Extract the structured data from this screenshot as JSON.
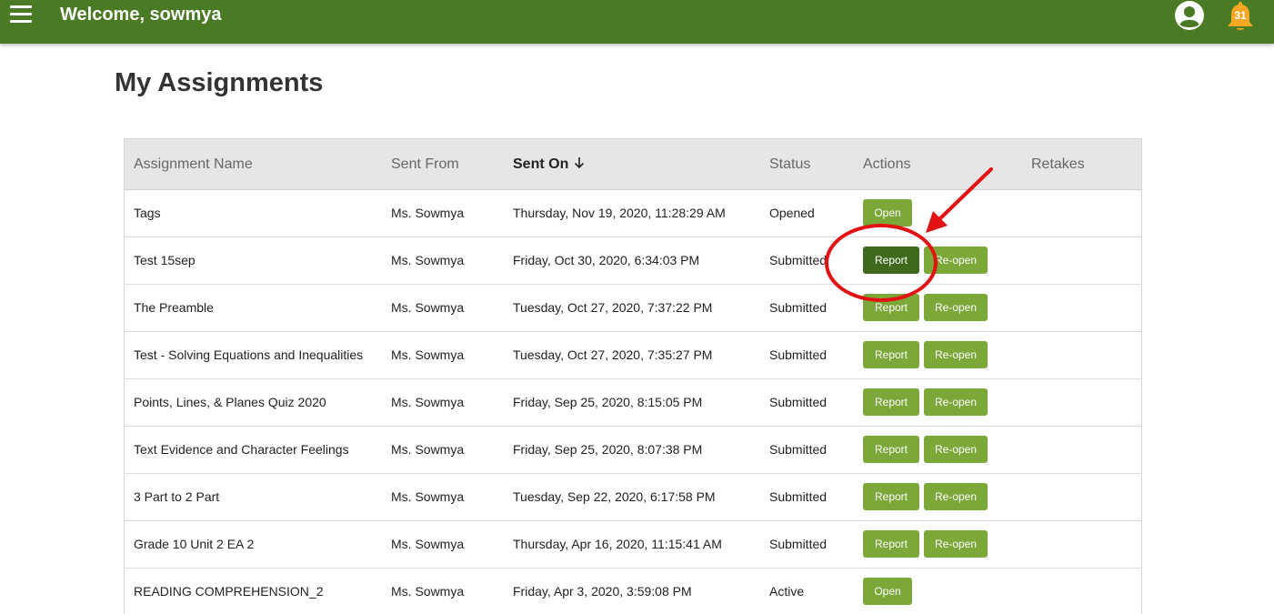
{
  "header": {
    "welcome": "Welcome, sowmya",
    "notification_count": "31",
    "bar_color": "#4a7a23"
  },
  "page": {
    "title": "My Assignments"
  },
  "table": {
    "columns": {
      "name": "Assignment Name",
      "from": "Sent From",
      "sent_on": "Sent On",
      "status": "Status",
      "actions": "Actions",
      "retakes": "Retakes"
    },
    "sort_icon": "arrow-down-icon",
    "rows": [
      {
        "name": "Tags",
        "from": "Ms. Sowmya",
        "sent_on": "Thursday, Nov 19, 2020, 11:28:29 AM",
        "status": "Opened",
        "actions": [
          "Open"
        ]
      },
      {
        "name": "Test 15sep",
        "from": "Ms. Sowmya",
        "sent_on": "Friday, Oct 30, 2020, 6:34:03 PM",
        "status": "Submitted",
        "actions": [
          "Report",
          "Re-open"
        ]
      },
      {
        "name": "The Preamble",
        "from": "Ms. Sowmya",
        "sent_on": "Tuesday, Oct 27, 2020, 7:37:22 PM",
        "status": "Submitted",
        "actions": [
          "Report",
          "Re-open"
        ]
      },
      {
        "name": "Test - Solving Equations and Inequalities",
        "from": "Ms. Sowmya",
        "sent_on": "Tuesday, Oct 27, 2020, 7:35:27 PM",
        "status": "Submitted",
        "actions": [
          "Report",
          "Re-open"
        ]
      },
      {
        "name": "Points, Lines, & Planes Quiz 2020",
        "from": "Ms. Sowmya",
        "sent_on": "Friday, Sep 25, 2020, 8:15:05 PM",
        "status": "Submitted",
        "actions": [
          "Report",
          "Re-open"
        ]
      },
      {
        "name": "Text Evidence and Character Feelings",
        "from": "Ms. Sowmya",
        "sent_on": "Friday, Sep 25, 2020, 8:07:38 PM",
        "status": "Submitted",
        "actions": [
          "Report",
          "Re-open"
        ]
      },
      {
        "name": "3 Part to 2 Part",
        "from": "Ms. Sowmya",
        "sent_on": "Tuesday, Sep 22, 2020, 6:17:58 PM",
        "status": "Submitted",
        "actions": [
          "Report",
          "Re-open"
        ]
      },
      {
        "name": "Grade 10 Unit 2 EA 2",
        "from": "Ms. Sowmya",
        "sent_on": "Thursday, Apr 16, 2020, 11:15:41 AM",
        "status": "Submitted",
        "actions": [
          "Report",
          "Re-open"
        ]
      },
      {
        "name": "READING COMPREHENSION_2",
        "from": "Ms. Sowmya",
        "sent_on": "Friday, Apr 3, 2020, 3:59:08 PM",
        "status": "Active",
        "actions": [
          "Open"
        ]
      }
    ]
  },
  "colors": {
    "button": "#7ca83a",
    "button_active": "#3f6a1d",
    "annotation": "#e31111",
    "bell": "#f5a623"
  }
}
